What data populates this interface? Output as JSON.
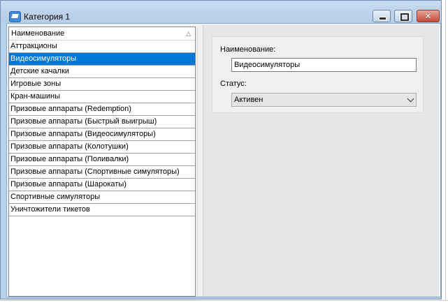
{
  "window": {
    "title": "Категория 1",
    "icon": "app-window-icon",
    "close_glyph": "✕"
  },
  "list": {
    "header": "Наименование",
    "sort_glyph": "△",
    "items": [
      {
        "label": "Аттракционы",
        "selected": false
      },
      {
        "label": "Видеосимуляторы",
        "selected": true
      },
      {
        "label": "Детские качалки",
        "selected": false
      },
      {
        "label": "Игровые зоны",
        "selected": false
      },
      {
        "label": "Кран-машины",
        "selected": false
      },
      {
        "label": "Призовые аппараты (Redemption)",
        "selected": false
      },
      {
        "label": "Призовые аппараты (Быстрый выигрыш)",
        "selected": false
      },
      {
        "label": "Призовые аппараты (Видеосимуляторы)",
        "selected": false
      },
      {
        "label": "Призовые аппараты (Колотушки)",
        "selected": false
      },
      {
        "label": "Призовые аппараты (Поливалки)",
        "selected": false
      },
      {
        "label": "Призовые аппараты (Спортивные симуляторы)",
        "selected": false
      },
      {
        "label": "Призовые аппараты (Шарокаты)",
        "selected": false
      },
      {
        "label": "Спортивные симуляторы",
        "selected": false
      },
      {
        "label": "Уничтожители тикетов",
        "selected": false
      }
    ]
  },
  "detail": {
    "name_label": "Наименование:",
    "name_value": "Видеосимуляторы",
    "status_label": "Статус:",
    "status_value": "Активен"
  },
  "colors": {
    "selection": "#0078d7",
    "titlebar": "#b9d1ea"
  }
}
